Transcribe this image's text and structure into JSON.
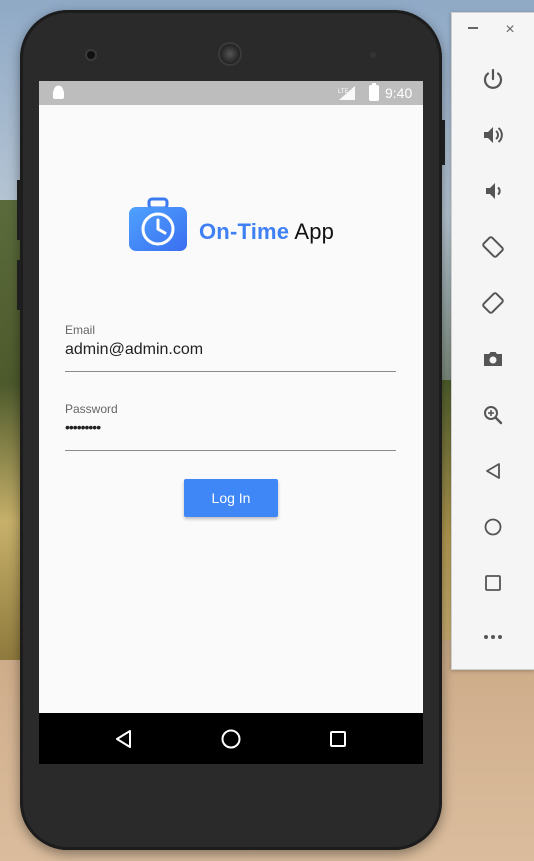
{
  "status_bar": {
    "time": "9:40"
  },
  "app": {
    "brand_part1": "On-Time",
    "brand_part2": " App",
    "email": {
      "label": "Email",
      "value": "admin@admin.com"
    },
    "password": {
      "label": "Password",
      "value": "•••••••••"
    },
    "login_label": "Log In"
  },
  "emulator_toolbar": {
    "close_glyph": "×",
    "items": [
      "power-icon",
      "volume-up-icon",
      "volume-down-icon",
      "rotate-left-icon",
      "rotate-right-icon",
      "screenshot-icon",
      "zoom-icon",
      "back-icon",
      "home-icon",
      "overview-icon",
      "more-icon"
    ]
  },
  "colors": {
    "accent": "#3f86f7",
    "brand_blue": "#3f80f5",
    "statusbar": "#bdbdbd"
  }
}
